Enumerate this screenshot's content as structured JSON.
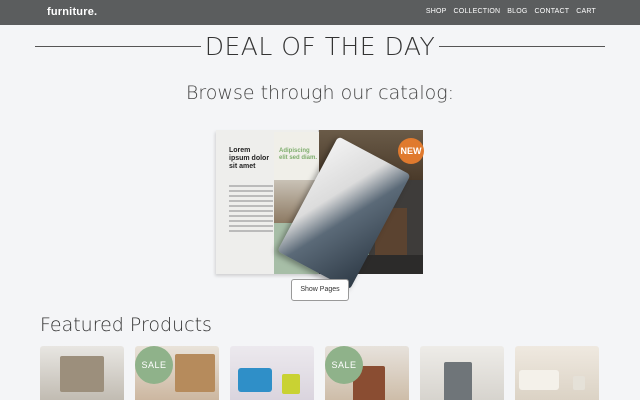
{
  "navbar": {
    "brand": "furniture",
    "brand_dot": ".",
    "links": [
      "SHOP",
      "COLLECTION",
      "BLOG",
      "CONTACT",
      "CART"
    ]
  },
  "deal": {
    "title": "DEAL OF THE DAY"
  },
  "catalog": {
    "subtitle": "Browse through our catalog:",
    "left_page_heading": "Lorem ipsum dolor sit amet",
    "green_heading": "Adipiscing elit sed diam.",
    "badge": "NEW",
    "show_pages_label": "Show Pages"
  },
  "featured": {
    "title": "Featured Products",
    "products": [
      {
        "name": "product-1",
        "sale": ""
      },
      {
        "name": "product-2",
        "sale": "SALE"
      },
      {
        "name": "product-3",
        "sale": ""
      },
      {
        "name": "product-4",
        "sale": "SALE"
      },
      {
        "name": "product-5",
        "sale": ""
      },
      {
        "name": "product-6",
        "sale": ""
      }
    ]
  }
}
